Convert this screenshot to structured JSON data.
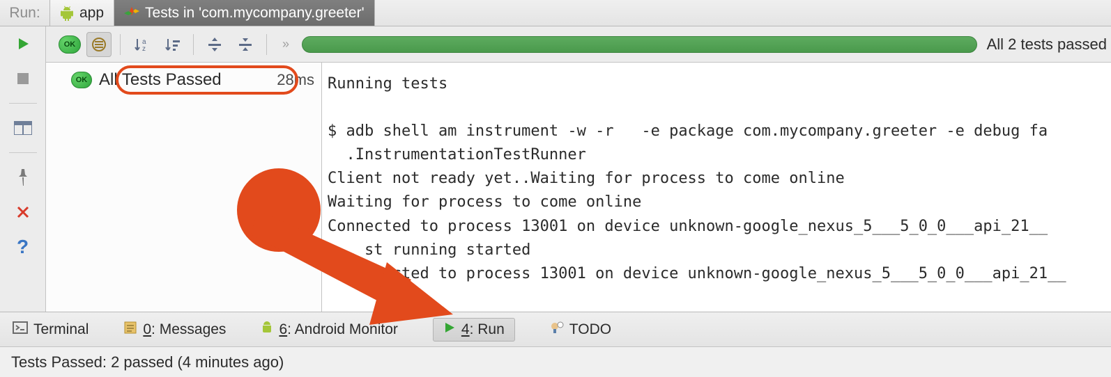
{
  "tab_strip": {
    "run_label": "Run:",
    "app_tab": "app",
    "test_tab": "Tests in 'com.mycompany.greeter'"
  },
  "toolbar": {
    "ok_badge": "OK",
    "progress_text": "All 2 tests passed"
  },
  "tree": {
    "root_label": "All Tests Passed",
    "root_timing": "28ms"
  },
  "console_lines": {
    "l0": "Running tests",
    "l1": "",
    "l2": "$ adb shell am instrument -w -r   -e package com.mycompany.greeter -e debug fa",
    "l3": "  .InstrumentationTestRunner",
    "l4": "Client not ready yet..Waiting for process to come online",
    "l5": "Waiting for process to come online",
    "l6": "Connected to process 13001 on device unknown-google_nexus_5___5_0_0___api_21__",
    "l7": "    st running started",
    "l8": "       cted to process 13001 on device unknown-google_nexus_5___5_0_0___api_21__"
  },
  "panel_tabs": {
    "terminal": "Terminal",
    "messages": "0: Messages",
    "android_monitor": "6: Android Monitor",
    "run": "4: Run",
    "todo": "TODO"
  },
  "status_bar": {
    "text": "Tests Passed: 2 passed (4 minutes ago)"
  }
}
